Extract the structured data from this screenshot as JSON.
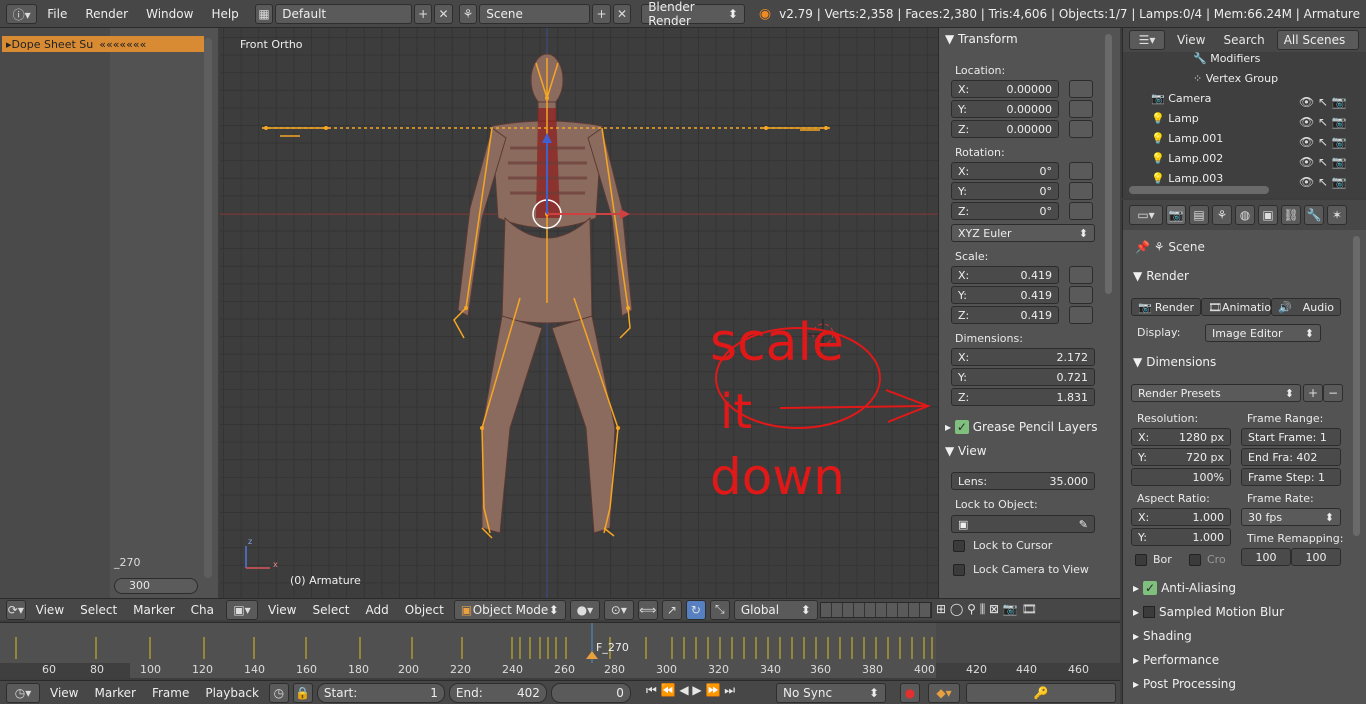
{
  "topbar": {
    "menus": [
      "File",
      "Render",
      "Window",
      "Help"
    ],
    "layout": "Default",
    "scene": "Scene",
    "engine": "Blender Render",
    "stats": "v2.79 | Verts:2,358 | Faces:2,380 | Tris:4,606 | Objects:1/7 | Lamps:0/4 | Mem:66.24M | Armature"
  },
  "dopesheet": {
    "channel": "Dope Sheet Su",
    "frame_label": "_270",
    "end_field": "300",
    "menus": [
      "View",
      "Select",
      "Marker",
      "Cha"
    ]
  },
  "viewport": {
    "title": "Front Ortho",
    "object_label": "(0) Armature",
    "menus": [
      "View",
      "Select",
      "Add",
      "Object"
    ],
    "mode": "Object Mode",
    "orientation": "Global",
    "annotation": [
      "scale",
      "it",
      "down"
    ]
  },
  "npanel": {
    "transform_title": "Transform",
    "location_label": "Location:",
    "location": [
      {
        "axis": "X:",
        "value": "0.00000"
      },
      {
        "axis": "Y:",
        "value": "0.00000"
      },
      {
        "axis": "Z:",
        "value": "0.00000"
      }
    ],
    "rotation_label": "Rotation:",
    "rotation": [
      {
        "axis": "X:",
        "value": "0°"
      },
      {
        "axis": "Y:",
        "value": "0°"
      },
      {
        "axis": "Z:",
        "value": "0°"
      }
    ],
    "rotation_mode": "XYZ Euler",
    "scale_label": "Scale:",
    "scale": [
      {
        "axis": "X:",
        "value": "0.419"
      },
      {
        "axis": "Y:",
        "value": "0.419"
      },
      {
        "axis": "Z:",
        "value": "0.419"
      }
    ],
    "dimensions_label": "Dimensions:",
    "dimensions": [
      {
        "axis": "X:",
        "value": "2.172"
      },
      {
        "axis": "Y:",
        "value": "0.721"
      },
      {
        "axis": "Z:",
        "value": "1.831"
      }
    ],
    "grease_pencil": "Grease Pencil Layers",
    "view_title": "View",
    "lens_label": "Lens:",
    "lens_value": "35.000",
    "lock_object_label": "Lock to Object:",
    "lock_cursor": "Lock to Cursor",
    "lock_camera": "Lock Camera to View"
  },
  "outliner": {
    "menus": [
      "View",
      "Search"
    ],
    "filter": "All Scenes",
    "items": [
      "Modifiers",
      "Vertex Group",
      "Camera",
      "Lamp",
      "Lamp.001",
      "Lamp.002",
      "Lamp.003"
    ]
  },
  "render": {
    "scene": "Scene",
    "section": "Render",
    "buttons": [
      "Render",
      "Animation",
      "Audio"
    ],
    "display_label": "Display:",
    "display_value": "Image Editor",
    "dimensions_title": "Dimensions",
    "presets": "Render Presets",
    "resolution_label": "Resolution:",
    "res_x": "1280 px",
    "res_y": "720 px",
    "res_pct": "100%",
    "frame_range_label": "Frame Range:",
    "start_frame": "Start Frame: 1",
    "end_frame": "End Fra: 402",
    "frame_step": "Frame Step: 1",
    "aspect_label": "Aspect Ratio:",
    "aspect_x": "1.000",
    "aspect_y": "1.000",
    "frame_rate_label": "Frame Rate:",
    "frame_rate": "30 fps",
    "bor": "Bor",
    "cro": "Cro",
    "time_remap_label": "Time Remapping:",
    "remap_old": "100",
    "remap_new": "100",
    "sections": [
      "Anti-Aliasing",
      "Sampled Motion Blur",
      "Shading",
      "Performance",
      "Post Processing"
    ]
  },
  "timeline": {
    "current": "F_270",
    "ticks": [
      "60",
      "80",
      "100",
      "120",
      "140",
      "160",
      "180",
      "200",
      "220",
      "240",
      "260",
      "280",
      "300",
      "320",
      "340",
      "360",
      "380",
      "400",
      "420",
      "440",
      "460"
    ],
    "menus": [
      "View",
      "Marker",
      "Frame",
      "Playback"
    ],
    "start_label": "Start:",
    "start": "1",
    "end_label": "End:",
    "end": "402",
    "frame": "0",
    "sync": "No Sync"
  }
}
